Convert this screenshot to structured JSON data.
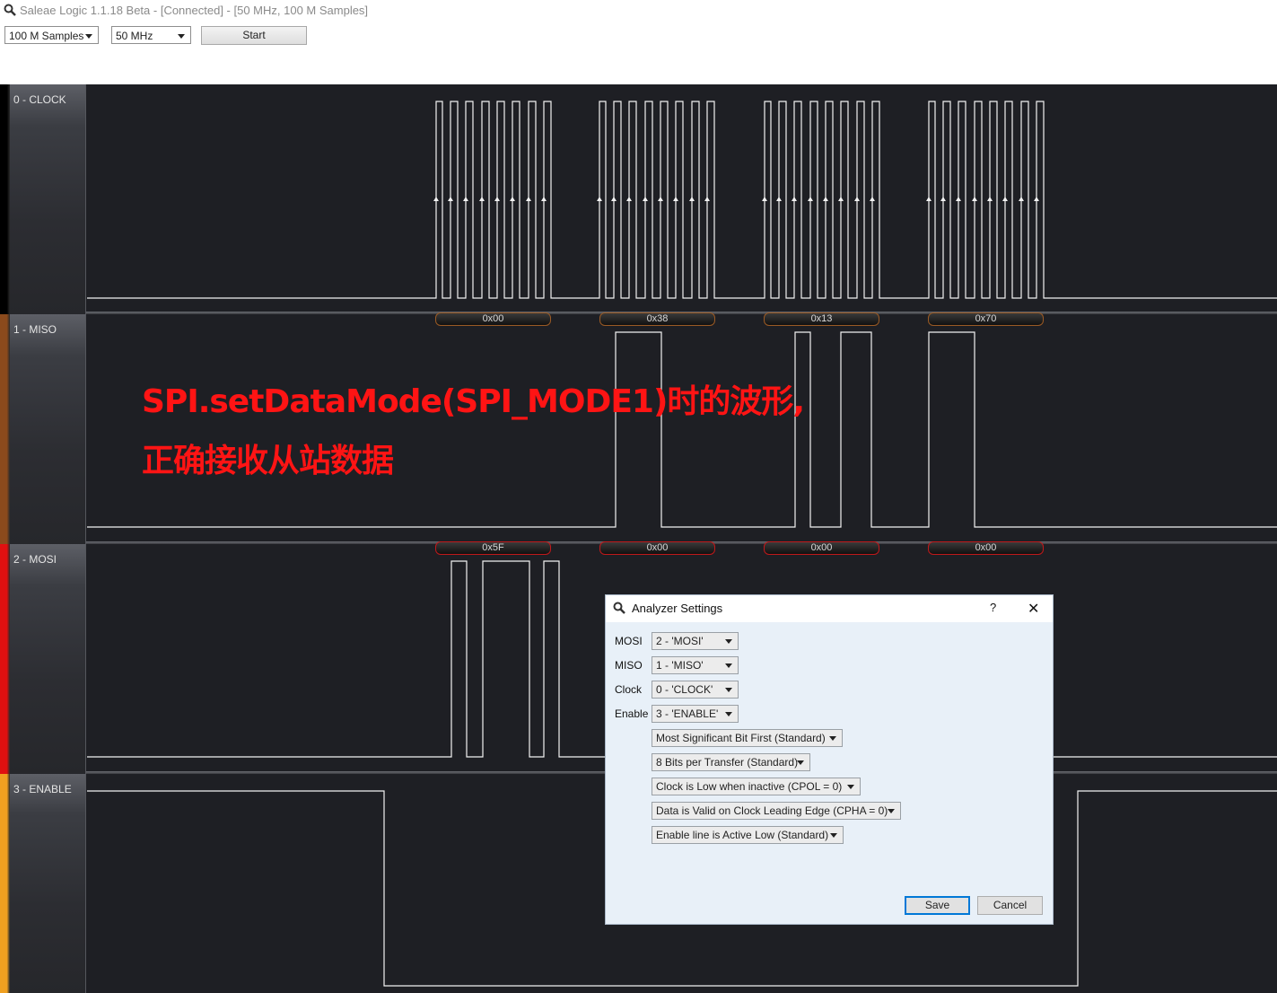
{
  "window": {
    "title": "Saleae Logic 1.1.18 Beta - [Connected] - [50 MHz, 100 M Samples]"
  },
  "toolbar": {
    "samples": "100 M Samples",
    "rate": "50 MHz",
    "start_label": "Start"
  },
  "channels": [
    {
      "label": "0 - CLOCK",
      "color": "#000000"
    },
    {
      "label": "1 - MISO",
      "color": "#8b4a1c"
    },
    {
      "label": "2 - MOSI",
      "color": "#e01010"
    },
    {
      "label": "3 - ENABLE",
      "color": "#f0a020"
    }
  ],
  "decoded": {
    "miso": [
      "0x00",
      "0x38",
      "0x13",
      "0x70"
    ],
    "mosi": [
      "0x5F",
      "0x00",
      "0x00",
      "0x00"
    ]
  },
  "annotation": {
    "line1": "SPI.setDataMode(SPI_MODE1)时的波形,",
    "line2": "正确接收从站数据"
  },
  "dialog": {
    "title": "Analyzer Settings",
    "help": "?",
    "close": "✕",
    "fields": [
      {
        "label": "MOSI",
        "value": "2 - 'MOSI'"
      },
      {
        "label": "MISO",
        "value": "1 - 'MISO'"
      },
      {
        "label": "Clock",
        "value": "0 - 'CLOCK'"
      },
      {
        "label": "Enable",
        "value": "3 - 'ENABLE'"
      }
    ],
    "options": [
      "Most Significant Bit First (Standard)",
      "8 Bits per Transfer (Standard)",
      "Clock is Low when inactive (CPOL = 0)",
      "Data is Valid on Clock Leading Edge (CPHA = 0)",
      "Enable line is Active Low (Standard)"
    ],
    "save_label": "Save",
    "cancel_label": "Cancel"
  }
}
